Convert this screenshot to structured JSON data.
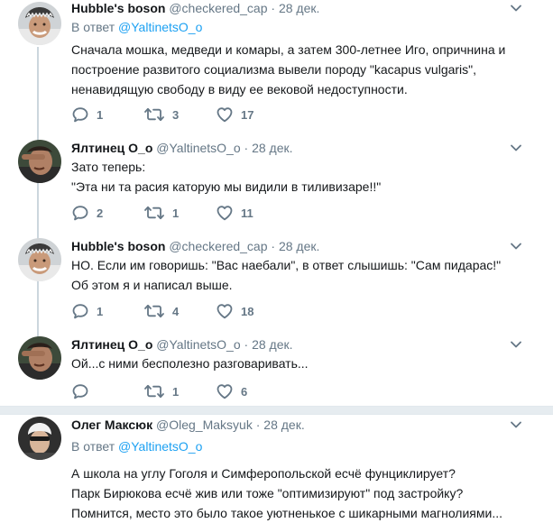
{
  "tweets": [
    {
      "name": "Hubble's boson",
      "handle": "@checkered_cap",
      "dot": "·",
      "date": "28 дек.",
      "reply_prefix": "В ответ",
      "reply_handle": "@YaltinetsO_o",
      "lines": [
        "Сначала мошка, медведи и комары, а затем 300-летнее Иго, опричнина и",
        "построение развитого социализма вывели породу \"kacapus vulgaris\",",
        "ненавидящую свободу в виду ее вековой недоступности."
      ],
      "replies": "1",
      "retweets": "3",
      "likes": "17"
    },
    {
      "name": "Ялтинец О_о",
      "handle": "@YaltinetsO_o",
      "dot": "·",
      "date": "28 дек.",
      "lines": [
        "Зато теперь:",
        "\"Эта ни та расия каторую мы видили в тиливизаре!!\""
      ],
      "replies": "2",
      "retweets": "1",
      "likes": "11"
    },
    {
      "name": "Hubble's boson",
      "handle": "@checkered_cap",
      "dot": "·",
      "date": "28 дек.",
      "lines": [
        "НО. Если им говоришь: \"Вас наебали\", в ответ слышишь: \"Сам пидарас!\"",
        "Об этом я и написал выше."
      ],
      "replies": "1",
      "retweets": "4",
      "likes": "18"
    },
    {
      "name": "Ялтинец О_о",
      "handle": "@YaltinetsO_o",
      "dot": "·",
      "date": "28 дек.",
      "lines": [
        "Ой...с ними бесполезно разговаривать..."
      ],
      "replies": "",
      "retweets": "1",
      "likes": "6"
    },
    {
      "name": "Олег Максюк",
      "handle": "@Oleg_Maksyuk",
      "dot": "·",
      "date": "28 дек.",
      "reply_prefix": "В ответ",
      "reply_handle": "@YaltinetsO_o",
      "lines": [
        "А школа на углу Гоголя и Симферопольской есчё фунциклирует?",
        "Парк Бирюкова есчё жив или тоже \"оптимизируют\" под застройку?",
        "Помнится, место это было такое уютненькое с шикарными магнолиями..."
      ]
    }
  ],
  "icons": {
    "reply": "reply-icon",
    "retweet": "retweet-icon",
    "like": "heart-icon",
    "menu": "chevron-down-icon"
  },
  "colors": {
    "link": "#1da1f2",
    "muted": "#657786",
    "thread_line": "#ccd6dd"
  }
}
